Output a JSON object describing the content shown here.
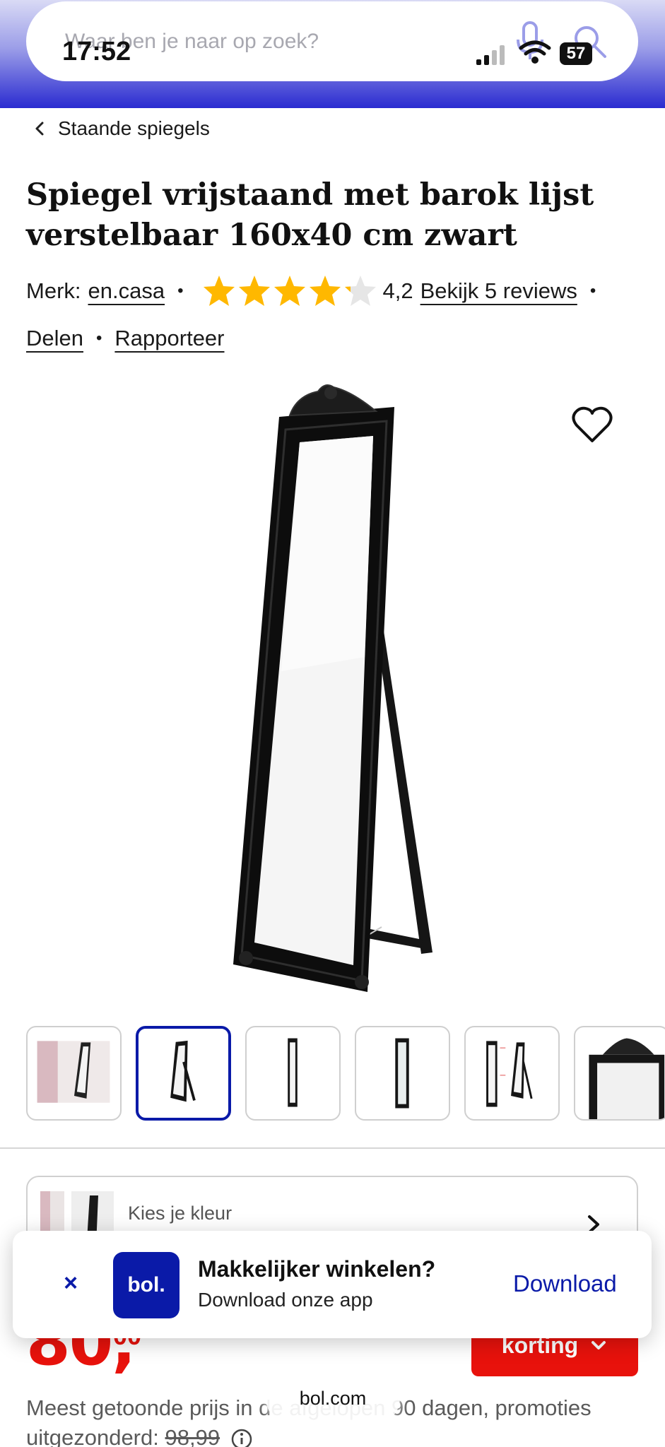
{
  "status_bar": {
    "time": "17:52",
    "battery": "57"
  },
  "search": {
    "placeholder": "Waar ben je naar op zoek?"
  },
  "breadcrumb": {
    "label": "Staande spiegels"
  },
  "product": {
    "title": "Spiegel vrijstaand met barok lijst verstelbaar 160x40 cm zwart",
    "brand_label": "Merk:",
    "brand": "en.casa",
    "rating": "4,2",
    "rating_value": 4.2,
    "reviews_link": "Bekijk 5 reviews",
    "share": "Delen",
    "report": "Rapporteer"
  },
  "thumbnails": {
    "count": 6,
    "active_index": 1
  },
  "color_picker": {
    "label": "Kies je kleur"
  },
  "price": {
    "main": "80,",
    "cents": "00",
    "discount_label": "korting"
  },
  "price_note": {
    "text": "Meest getoonde prijs in de afgelopen 90 dagen, promoties uitgezonderd:",
    "old_price": "98,99"
  },
  "app_banner": {
    "close": "×",
    "logo": "bol.",
    "title": "Makkelijker winkelen?",
    "subtitle": "Download onze app",
    "action": "Download"
  },
  "url_bar": {
    "domain": "bol.com"
  },
  "colors": {
    "brand_blue": "#0a1aa8",
    "price_red": "#e8120c",
    "star": "#ffb800"
  }
}
